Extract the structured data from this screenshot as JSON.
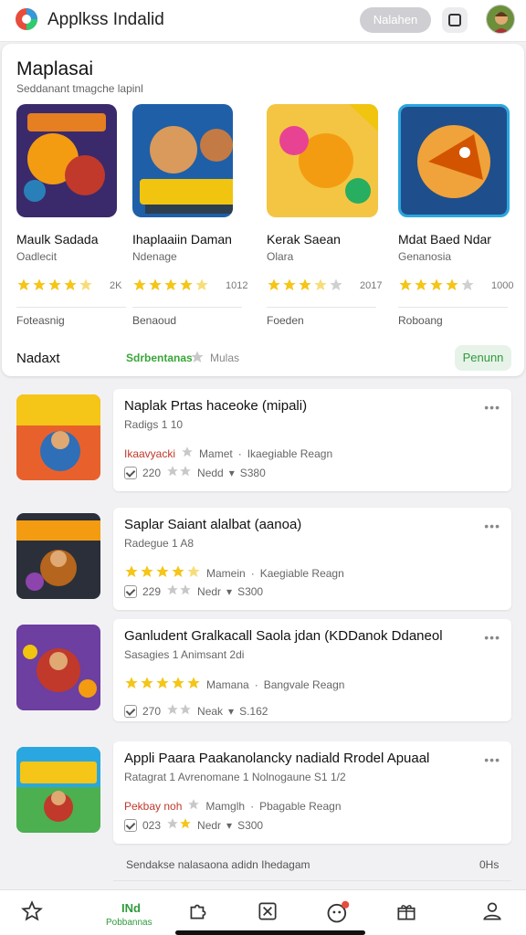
{
  "header": {
    "title": "Applkss Indalid",
    "pill_button": "Nalahen"
  },
  "featured": {
    "title": "Maplasai",
    "subtitle": "Seddanant tmagche lapinl",
    "items": [
      {
        "name": "Maulk Sadada",
        "dev": "Oadlecit",
        "rating": 4.5,
        "count": "2K",
        "tag": "Foteasnig"
      },
      {
        "name": "Ihaplaaiin Daman",
        "dev": "Ndenage",
        "rating": 4.5,
        "count": "1012",
        "tag": "Benaoud"
      },
      {
        "name": "Kerak Saean",
        "dev": "Olara",
        "rating": 3.5,
        "count": "2017",
        "tag": "Foeden"
      },
      {
        "name": "Mdat Baed Ndar",
        "dev": "Genanosia",
        "rating": 4.0,
        "count": "1000",
        "tag": "Roboang"
      }
    ],
    "footer_label": "Nadaxt",
    "footer_green": "Sdrbentanas",
    "footer_gray": "Mulas",
    "footer_button": "Penunn"
  },
  "list": [
    {
      "title": "Naplak Prtas haceoke (mipali)",
      "sub": "Radigs 1 10",
      "left": "Ikaavyacki",
      "leftRed": true,
      "stars": 0,
      "mid": "Mamet",
      "right": "Ikaegiable Reagn",
      "num": "220",
      "b": "Nedd",
      "price": "S380"
    },
    {
      "title": "Saplar Saiant alalbat (aanoa)",
      "sub": "Radegue 1 A8",
      "left": "",
      "leftRed": false,
      "stars": 4.5,
      "mid": "Mamein",
      "right": "Kaegiable Reagn",
      "num": "229",
      "b": "Nedr",
      "price": "S300"
    },
    {
      "title": "Ganludent Gralkacall Saola jdan (KDDanok Ddaneol",
      "sub": "Sasagies 1 Animsant 2di",
      "left": "",
      "leftRed": false,
      "stars": 5,
      "mid": "Mamana",
      "right": "Bangvale Reagn",
      "num": "270",
      "b": "Neak",
      "price": "S.162"
    },
    {
      "title": "Appli Paara Paakanolancky nadiald Rrodel Apuaal",
      "sub": "Ratagrat 1 Avrenomane 1 Nolnogaune S1 1/2",
      "left": "Pekbay noh",
      "leftRed": true,
      "stars": 0,
      "mid": "Mamglh",
      "right": "Pbagable Reagn",
      "num": "023",
      "b": "Nedr",
      "price": "S300"
    }
  ],
  "foot_note": "Sendakse nalasaona adidn Ihedagam",
  "foot_num": "0Hs",
  "nav": {
    "active_icon": "INd",
    "active_label": "Pobbannas"
  }
}
